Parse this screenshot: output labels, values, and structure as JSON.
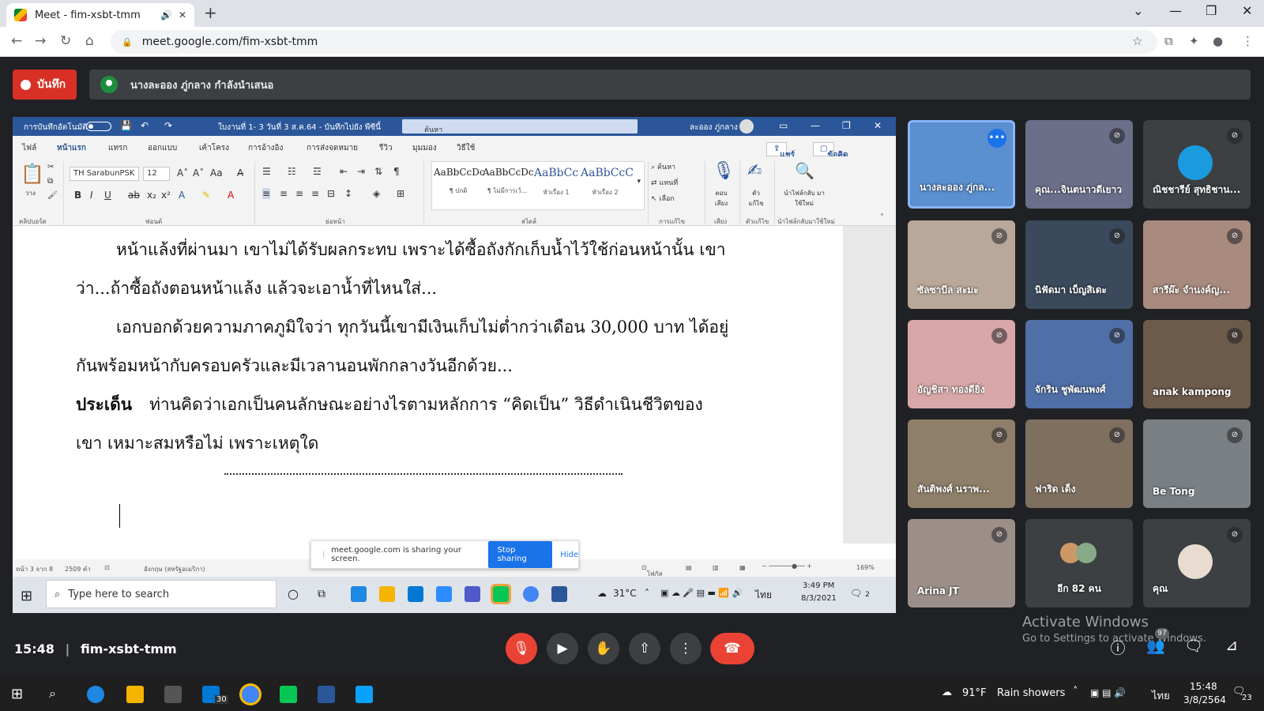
{
  "browser": {
    "tab_title": "Meet - fim-xsbt-tmm",
    "url": "meet.google.com/fim-xsbt-tmm"
  },
  "meet": {
    "record_label": "บันทึก",
    "presenting_text": "นางละออง ภู่กลาง กำลังนำเสนอ",
    "time": "15:48",
    "meeting_code": "fim-xsbt-tmm",
    "participants_badge": "97",
    "activate_title": "Activate Windows",
    "activate_sub": "Go to Settings to activate Windows."
  },
  "word": {
    "autosave": "การบันทึกอัตโนมัติ",
    "doc_title": "ใบงานที่ 1- 3 วันที่ 3 ส.ค.64 - บันทึกไปยัง พีซีนี้",
    "search_placeholder": "ค้นหา",
    "user": "ละออง ภู่กลาง",
    "menu": [
      "ไฟล์",
      "หน้าแรก",
      "แทรก",
      "ออกแบบ",
      "เค้าโครง",
      "การอ้างอิง",
      "การส่งจดหมาย",
      "รีวิว",
      "มุมมอง",
      "วิธีใช้"
    ],
    "share": "แชร์",
    "comments": "ข้อคิดเห็น",
    "font_name": "TH SarabunPSK",
    "font_size": "12",
    "styles": [
      {
        "sample": "AaBbCcDc",
        "label": "¶ ปกติ"
      },
      {
        "sample": "AaBbCcDc",
        "label": "¶ ไม่มีการเว้..."
      },
      {
        "sample": "AaBbCc",
        "label": "หัวเรื่อง 1"
      },
      {
        "sample": "AaBbCcC",
        "label": "หัวเรื่อง 2"
      }
    ],
    "groups": [
      "คลิปบอร์ด",
      "ฟอนต์",
      "ย่อหน้า",
      "สไตล์",
      "การแก้ไข",
      "เสียง",
      "ตัวแก้ไข",
      "นำไฟล์กลับมาใช้ใหม่"
    ],
    "ribbon_find": "ค้นหา",
    "ribbon_replace": "แทนที่",
    "ribbon_select": "เลือก",
    "ribbon_dictate": "ตอบ เสียง",
    "ribbon_editor": "ตัว แก้ไข",
    "ribbon_reuse": "นำไฟล์กลับ มาใช้ใหม่",
    "paste": "วาง",
    "doc_lines": [
      "หน้าแล้งที่ผ่านมา เขาไม่ได้รับผลกระทบ เพราะได้ซื้อถังกักเก็บน้ำไว้ใช้ก่อนหน้านั้น เขา",
      "ว่า...ถ้าซื้อถังตอนหน้าแล้ง แล้วจะเอาน้ำที่ไหนใส่...",
      "เอกบอกด้วยความภาคภูมิใจว่า ทุกวันนี้เขามีเงินเก็บไม่ต่ำกว่าเดือน 30,000 บาท ได้อยู่",
      "กันพร้อมหน้ากับครอบครัวและมีเวลานอนพักกลางวันอีกด้วย...",
      "ท่านคิดว่าเอกเป็นคนลักษณะอย่างไรตามหลักการ “คิดเป็น” วิธีดำเนินชีวิตของ",
      "เขา เหมาะสมหรือไม่    เพราะเหตุใด"
    ],
    "issue_label": "ประเด็น",
    "status_page": "หน้า 3 จาก 8",
    "status_words": "2509 คำ",
    "status_lang": "อังกฤษ (สหรัฐอเมริกา)",
    "status_focus": "โฟกัส",
    "zoom": "169%"
  },
  "share_popup": {
    "text": "meet.google.com is sharing your screen.",
    "stop": "Stop sharing",
    "hide": "Hide"
  },
  "inner_taskbar": {
    "search": "Type here to search",
    "temp": "31°C",
    "lang": "ไทย",
    "time": "3:49 PM",
    "date": "8/3/2021",
    "notif": "2"
  },
  "tiles": [
    {
      "name": "นางละออง ภู่กล...",
      "bg": "#5a8fd0"
    },
    {
      "name": "คุณ...จินตนาวดีเยาว",
      "bg": "#6b6f8a"
    },
    {
      "name": "ณิชชารีย์ สุทธิชาน...",
      "bg": "#3c4043"
    },
    {
      "name": "ซัลซาบีล สะมะ",
      "bg": "#b9a899"
    },
    {
      "name": "นิฟัดมา เบ็ญสิเดะ",
      "bg": "#3a4a5c"
    },
    {
      "name": "สารีผ๊ะ จำนงค์ญ...",
      "bg": "#a88a7e"
    },
    {
      "name": "อัญชิสา ทองดียิ่ง",
      "bg": "#d9a7a7"
    },
    {
      "name": "จักริน ชูพัฒนพงศ์",
      "bg": "#4f6fa6"
    },
    {
      "name": "anak kampong",
      "bg": "#6c5a4a"
    },
    {
      "name": "สันติพงศ์ นราพ...",
      "bg": "#8f7f6a"
    },
    {
      "name": "ฟาริด เด็ง",
      "bg": "#7f6f5f"
    },
    {
      "name": "Be Tong",
      "bg": "#7a7f84"
    },
    {
      "name": "Arina JT",
      "bg": "#9c8f8a"
    },
    {
      "name": "อีก 82 คน",
      "bg": "#3c4043"
    },
    {
      "name": "คุณ",
      "bg": "#3c4043"
    }
  ],
  "os_taskbar": {
    "badge_mail": "30",
    "weather": "91°F",
    "weather_text": "Rain showers",
    "lang": "ไทย",
    "time": "15:48",
    "date": "3/8/2564",
    "notif": "23"
  },
  "colors": {
    "meet_bg": "#202124",
    "record_red": "#d93025",
    "word_blue": "#2b579a",
    "end_call": "#ea4335",
    "stop_share": "#1a73e8"
  }
}
